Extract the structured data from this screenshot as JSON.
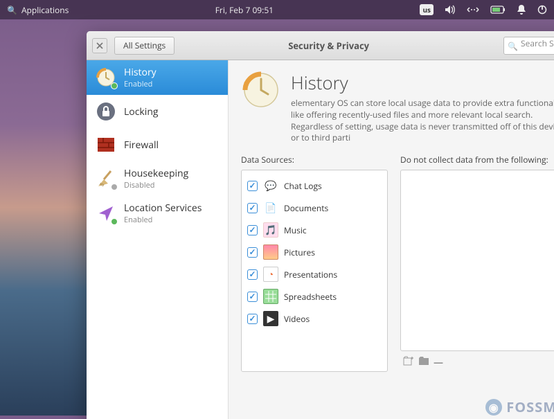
{
  "panel": {
    "apps_label": "Applications",
    "datetime": "Fri, Feb  7    09:51",
    "kbd_layout": "us"
  },
  "window": {
    "back_label": "All Settings",
    "title": "Security & Privacy",
    "search_placeholder": "Search Set"
  },
  "sidebar": {
    "items": [
      {
        "label": "History",
        "sub": "Enabled",
        "active": true
      },
      {
        "label": "Locking",
        "sub": ""
      },
      {
        "label": "Firewall",
        "sub": ""
      },
      {
        "label": "Housekeeping",
        "sub": "Disabled"
      },
      {
        "label": "Location Services",
        "sub": "Enabled"
      }
    ]
  },
  "main": {
    "title": "History",
    "desc": "elementary OS can store local usage data to provide extra functionality like offering recently-used files and more relevant local search. Regardless of setting, usage data is never transmitted off of this device or to third parti",
    "sources_label": "Data Sources:",
    "exclude_label": "Do not collect data from the following:",
    "sources": [
      {
        "label": "Chat Logs",
        "checked": true
      },
      {
        "label": "Documents",
        "checked": true
      },
      {
        "label": "Music",
        "checked": true
      },
      {
        "label": "Pictures",
        "checked": true
      },
      {
        "label": "Presentations",
        "checked": true
      },
      {
        "label": "Spreadsheets",
        "checked": true
      },
      {
        "label": "Videos",
        "checked": true
      }
    ]
  },
  "watermark": "FOSSMint"
}
